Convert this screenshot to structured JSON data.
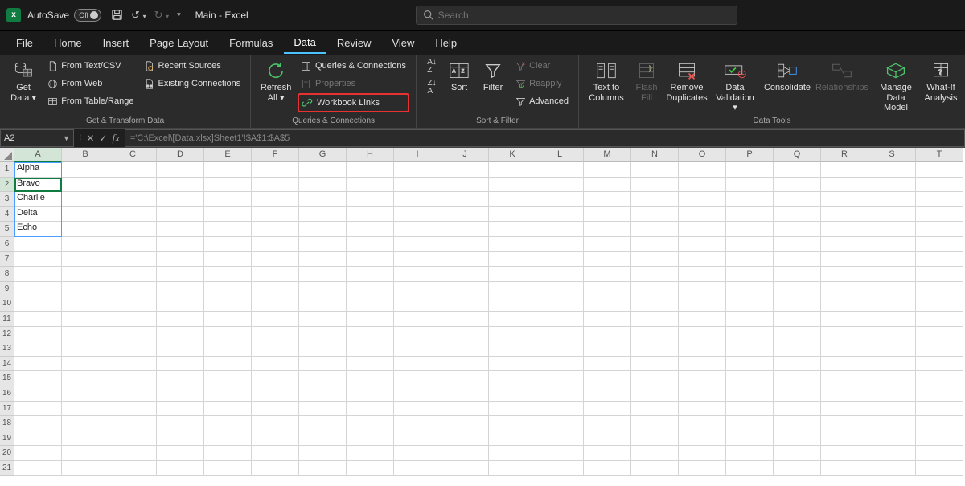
{
  "titlebar": {
    "autosave_label": "AutoSave",
    "autosave_state": "Off",
    "doc_title": "Main  -  Excel",
    "search_placeholder": "Search"
  },
  "tabs": [
    "File",
    "Home",
    "Insert",
    "Page Layout",
    "Formulas",
    "Data",
    "Review",
    "View",
    "Help"
  ],
  "active_tab": "Data",
  "ribbon": {
    "get_transform": {
      "label": "Get & Transform Data",
      "get_data": "Get Data",
      "from_text_csv": "From Text/CSV",
      "from_web": "From Web",
      "from_table_range": "From Table/Range",
      "recent_sources": "Recent Sources",
      "existing_connections": "Existing Connections"
    },
    "queries_conn": {
      "label": "Queries & Connections",
      "refresh_all": "Refresh All",
      "queries_connections": "Queries & Connections",
      "properties": "Properties",
      "workbook_links": "Workbook Links"
    },
    "sort_filter": {
      "label": "Sort & Filter",
      "sort": "Sort",
      "filter": "Filter",
      "clear": "Clear",
      "reapply": "Reapply",
      "advanced": "Advanced"
    },
    "data_tools": {
      "label": "Data Tools",
      "text_to_columns": "Text to Columns",
      "flash_fill": "Flash Fill",
      "remove_duplicates": "Remove Duplicates",
      "data_validation": "Data Validation",
      "consolidate": "Consolidate",
      "relationships": "Relationships",
      "manage_data_model": "Manage Data Model",
      "what_if": "What-If Analysis"
    }
  },
  "namebox": "A2",
  "formula": "='C:\\Excel\\[Data.xlsx]Sheet1'!$A$1:$A$5",
  "columns": [
    "A",
    "B",
    "C",
    "D",
    "E",
    "F",
    "G",
    "H",
    "I",
    "J",
    "K",
    "L",
    "M",
    "N",
    "O",
    "P",
    "Q",
    "R",
    "S",
    "T"
  ],
  "row_count": 21,
  "cell_data": {
    "A1": "Alpha",
    "A2": "Bravo",
    "A3": "Charlie",
    "A4": "Delta",
    "A5": "Echo"
  },
  "selected_cell": "A2",
  "linked_range": "A1:A5"
}
